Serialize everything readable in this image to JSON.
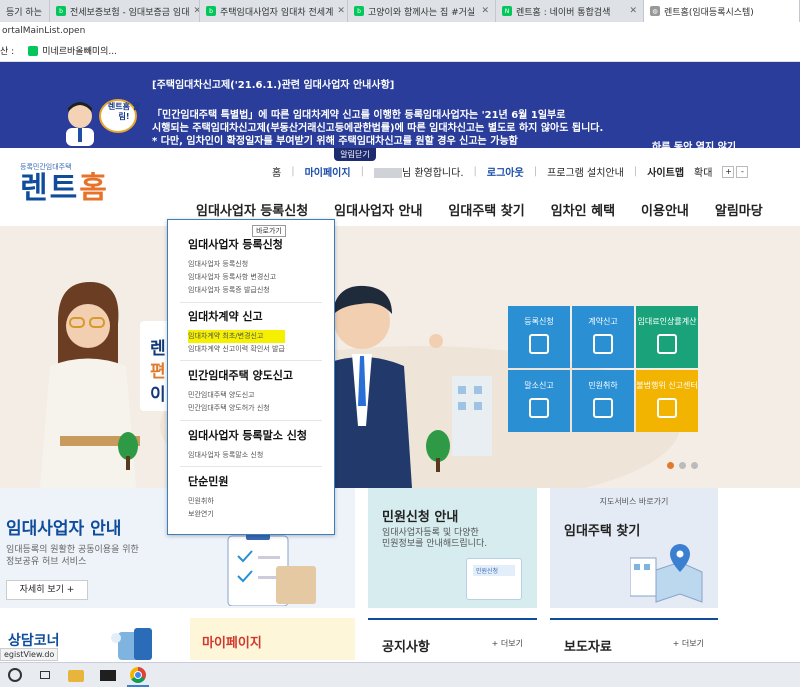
{
  "browser": {
    "tabs": [
      {
        "label": "등기 하는",
        "color": "#888888"
      },
      {
        "label": "전세보증보험 - 임대보증금 임대",
        "color": "#03c75a"
      },
      {
        "label": "주택임대사업자 임대차 전세계",
        "color": "#03c75a"
      },
      {
        "label": "고양이와 함께사는 집 #거실",
        "color": "#03c75a"
      },
      {
        "label": "렌트홈 : 네이버 통합검색",
        "color": "#03c75a"
      },
      {
        "label": "렌트홈(임대등록시스템)",
        "color": "#999999"
      }
    ],
    "url": "ortalMainList.open",
    "bookmarks": [
      {
        "label": "산 :"
      },
      {
        "label": "미네르바올빼미의..."
      }
    ]
  },
  "banner": {
    "title": "[주택임대차신고제('21.6.1.)관련 임대사업자 안내사항]",
    "line1": "「민간임대주택 특별법」에 따른 임대차계약 신고를 이행한 등록임대사업자는 '21년 6월 1일부로",
    "line2": "시행되는 주택임대차신고제(부동산거래신고등에관한법률)에 따른 임대차신고는 별도로 하지 않아도 됩니다.",
    "line3": "* 다만, 임차인이 확정일자를 부여받기 위해 주택임대차신고를 원할 경우 신고는 가능함",
    "badge": "렌트홈 알림!",
    "no_show": "하루 동안 열지 않기",
    "close_label": "알림닫기"
  },
  "header": {
    "logo_sub": "등록민간임대주택",
    "logo_main_1": "렌트",
    "logo_main_2": "홈",
    "topnav": {
      "home": "홈",
      "mypage": "마이페이지",
      "welcome": "님 환영합니다.",
      "logout": "로그아웃",
      "install": "프로그램 설치안내",
      "sitemap": "사이트맵",
      "zoom": "확대",
      "zoom_in": "+",
      "zoom_out": "-"
    },
    "gnb": [
      "임대사업자 등록신청",
      "임대사업자 안내",
      "임대주택 찾기",
      "임차인 혜택",
      "이용안내",
      "알림마당"
    ]
  },
  "hero": {
    "bubble_lines": [
      "렌",
      "편",
      "이"
    ],
    "tiles": [
      {
        "label": "등록신청",
        "color": "#2b8fd4"
      },
      {
        "label": "계약신고",
        "color": "#2b8fd4"
      },
      {
        "label": "임대료인상률계산",
        "color": "#1aa37a"
      },
      {
        "label": "말소신고",
        "color": "#2b8fd4"
      },
      {
        "label": "민원취하",
        "color": "#2b8fd4"
      },
      {
        "label": "불법행위 신고센터",
        "color": "#f2b400"
      }
    ]
  },
  "dropdown": {
    "tooltip": "바로가기",
    "groups": [
      {
        "title": "임대사업자 등록신청",
        "items": [
          "임대사업자 등록신청",
          "임대사업자 등록사항 변경신고",
          "임대사업자 등록증 발급신청"
        ]
      },
      {
        "title": "임대차계약 신고",
        "items": [
          "임대차계약 최초/변경신고",
          "임대차계약 신고이력 확인서 발급"
        ]
      },
      {
        "title": "민간임대주택 양도신고",
        "items": [
          "민간임대주택 양도신고",
          "민간임대주택 양도허가 신청"
        ]
      },
      {
        "title": "임대사업자 등록말소 신청",
        "items": [
          "임대사업자 등록말소 신청"
        ]
      },
      {
        "title": "단순민원",
        "items": [
          "민원취하",
          "보완연기"
        ]
      }
    ]
  },
  "sections": {
    "reg_info": {
      "title": "임대사업자 안내",
      "desc1": "임대등록의 원활한 공동이용을 위한",
      "desc2": "정보공유 허브 서비스",
      "more": "자세히 보기 +"
    },
    "civil": {
      "title": "민원신청 안내",
      "desc1": "임대사업자등록 및 다양한",
      "desc2": "민원정보를 안내해드립니다.",
      "card": "민원신청"
    },
    "rent": {
      "sub": "지도서비스 바로가기",
      "title": "임대주택 찾기"
    },
    "counsel": {
      "title": "상담코너"
    },
    "mypage": {
      "title": "마이페이지"
    },
    "notice": {
      "title": "공지사항",
      "more": "+ 더보기"
    },
    "press": {
      "title": "보도자료",
      "more": "+ 더보기"
    }
  },
  "status_text": "egistView.do"
}
